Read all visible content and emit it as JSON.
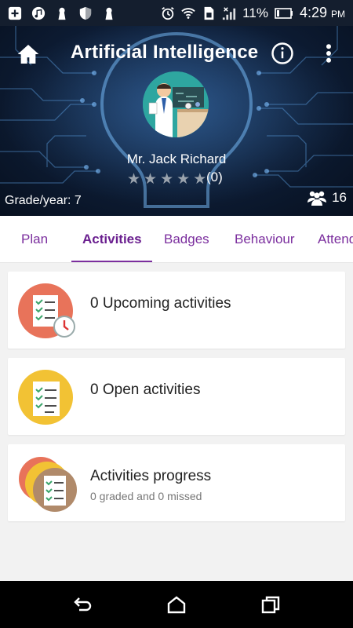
{
  "status_bar": {
    "battery_percent": "11%",
    "time": "4:29",
    "ampm": "PM",
    "icons": [
      "add-icon",
      "music-icon",
      "keyhole-icon",
      "shield-icon",
      "alarm-icon",
      "wifi-icon",
      "sim-icon",
      "signal-icon",
      "battery-icon"
    ]
  },
  "header": {
    "title": "Artificial Intelligence",
    "teacher_name": "Mr. Jack Richard",
    "rating_count": "(0)",
    "rating_stars": 0,
    "grade": "Grade/year: 7",
    "student_count": "16"
  },
  "tabs": [
    {
      "label": "Plan"
    },
    {
      "label": "Activities"
    },
    {
      "label": "Badges"
    },
    {
      "label": "Behaviour"
    },
    {
      "label": "Attendance"
    }
  ],
  "active_tab": "Activities",
  "cards": [
    {
      "title": "0 Upcoming activities",
      "subtitle": "",
      "icon": "upcoming-activities-icon",
      "color": "#e8735a"
    },
    {
      "title": "0 Open activities",
      "subtitle": "",
      "icon": "open-activities-icon",
      "color": "#f2c234"
    },
    {
      "title": "Activities progress",
      "subtitle": "0 graded and 0 missed",
      "icon": "activities-progress-icon",
      "color": "#b08a6a"
    }
  ],
  "colors": {
    "accent": "#7b2e9e",
    "hero_bg": "#0d1c34",
    "status_bar": "#141e2e",
    "nav_bar": "#000000"
  }
}
